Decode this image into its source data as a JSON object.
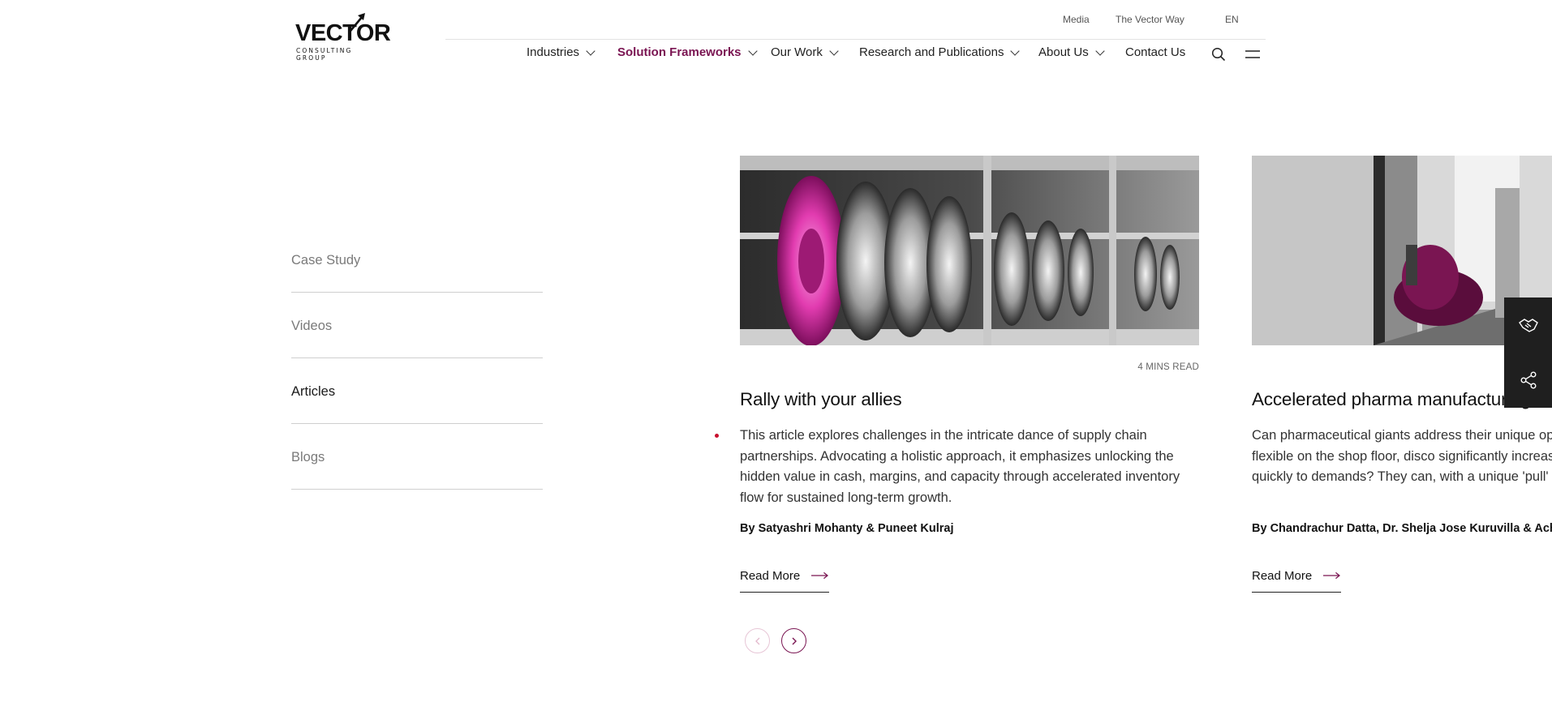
{
  "header": {
    "logo_text": "VECTOR",
    "logo_subtext": "CONSULTING GROUP",
    "top_links": [
      "Media",
      "The Vector Way",
      "EN"
    ],
    "nav": [
      {
        "label": "Industries",
        "has_dropdown": true,
        "active": false
      },
      {
        "label": "Solution Frameworks",
        "has_dropdown": true,
        "active": true
      },
      {
        "label": "Our Work",
        "has_dropdown": true,
        "active": false
      },
      {
        "label": "Research and Publications",
        "has_dropdown": true,
        "active": false
      },
      {
        "label": "About Us",
        "has_dropdown": true,
        "active": false
      },
      {
        "label": "Contact Us",
        "has_dropdown": false,
        "active": false
      }
    ],
    "icons": [
      "search-icon",
      "hamburger-menu-icon"
    ]
  },
  "filters": [
    {
      "label": "Case Study",
      "active": false
    },
    {
      "label": "Videos",
      "active": false
    },
    {
      "label": "Articles",
      "active": true
    },
    {
      "label": "Blogs",
      "active": false
    }
  ],
  "cards": [
    {
      "read_time": "4 MINS READ",
      "title": "Rally with your allies",
      "description": "This article explores challenges in the intricate dance of supply chain partnerships. Advocating a holistic approach, it emphasizes unlocking the hidden value in cash, margins, and capacity through accelerated inventory flow for sustained long-term growth.",
      "author": "By Satyashri Mohanty & Puneet Kulraj",
      "read_more": "Read More",
      "image": "alloy-wheels-on-rack"
    },
    {
      "read_time": "",
      "title": "Accelerated pharma manufacturing",
      "description": "Can pharmaceutical giants address their unique op help them be more flexible on the shop floor, disco significantly increase output and respond quickly to demands? They can, with a unique 'pull' based app",
      "author": "By Chandrachur Datta, Dr. Shelja Jose Kuruvilla & Acha",
      "read_more": "Read More",
      "image": "pharma-machinery"
    }
  ],
  "pager": {
    "prev_icon": "chevron-left-icon",
    "next_icon": "chevron-right-icon"
  },
  "side_tools": [
    "handshake-icon",
    "share-icon"
  ],
  "colors": {
    "accent": "#7a1552",
    "magenta_highlight": "#e23cb0",
    "text": "#1a1a1a",
    "muted": "#7a7a7a",
    "bullet": "#c8102e",
    "side_bar": "#1f1f1f"
  }
}
